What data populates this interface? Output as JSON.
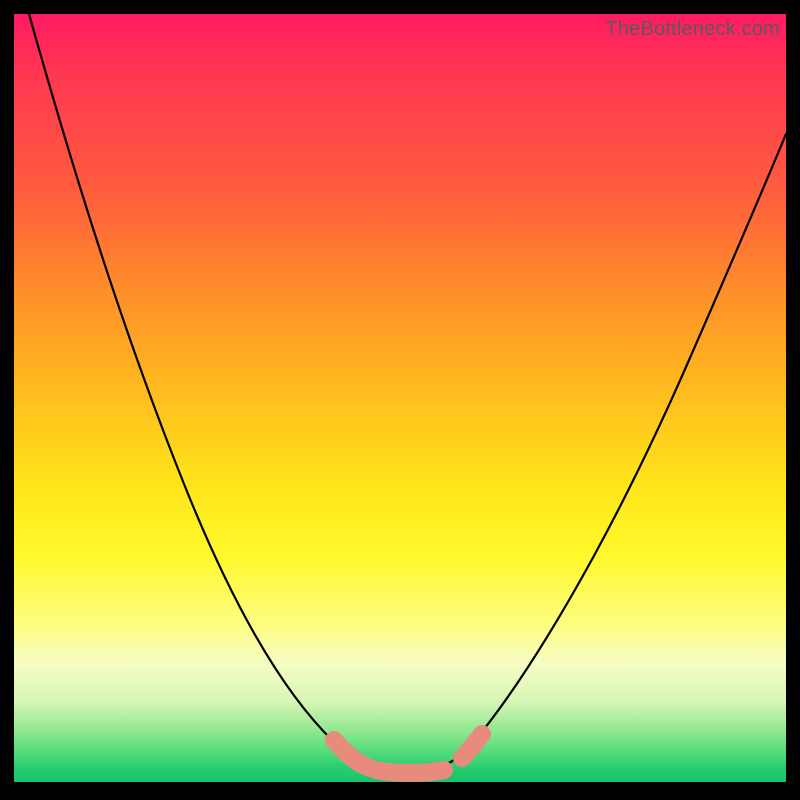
{
  "watermark": "TheBottleneck.com",
  "colors": {
    "background": "#000000",
    "curve": "#000000",
    "highlight_stroke": "#e88b7d",
    "gradient_top": "#ff1a62",
    "gradient_mid": "#ffe21a",
    "gradient_bottom": "#16c46c"
  },
  "chart_data": {
    "type": "line",
    "title": "",
    "xlabel": "",
    "ylabel": "",
    "xlim": [
      0,
      100
    ],
    "ylim": [
      0,
      100
    ],
    "grid": false,
    "legend": false,
    "series": [
      {
        "name": "bottleneck-curve",
        "x": [
          2,
          6,
          10,
          14,
          18,
          22,
          26,
          30,
          34,
          38,
          40,
          42,
          44,
          46,
          48,
          50,
          52,
          54,
          56,
          58,
          62,
          66,
          70,
          74,
          78,
          82,
          86,
          90,
          94,
          98
        ],
        "y": [
          100,
          90,
          80,
          70,
          61,
          52,
          44,
          36,
          28,
          20,
          16,
          12,
          8,
          5,
          3,
          2,
          2,
          2,
          3,
          5,
          10,
          17,
          24,
          31,
          38,
          45,
          52,
          59,
          66,
          73
        ]
      }
    ],
    "highlight_segments": [
      {
        "x0": 42,
        "y0": 8,
        "x1": 45,
        "y1": 4
      },
      {
        "x0": 46,
        "y0": 3,
        "x1": 54,
        "y1": 2
      },
      {
        "x0": 56,
        "y0": 4,
        "x1": 58,
        "y1": 6
      }
    ]
  }
}
